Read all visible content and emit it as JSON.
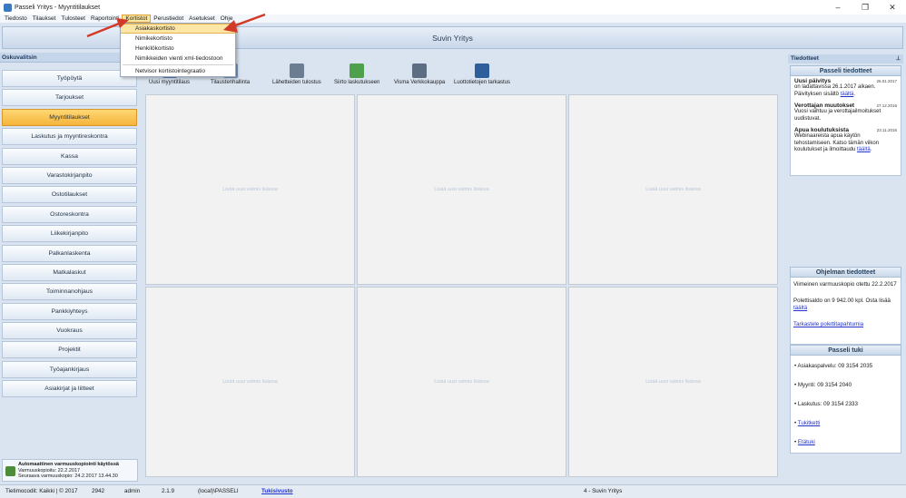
{
  "window": {
    "title": "Passeli Yritys - Myyntitilaukset",
    "minimize": "–",
    "maximize": "❐",
    "close": "✕"
  },
  "menubar": {
    "items": [
      "Tiedosto",
      "Tilaukset",
      "Tulosteet",
      "Raportointi",
      "Kortistot",
      "Perustiedot",
      "Asetukset",
      "Ohje"
    ],
    "active_index": 4
  },
  "dropdown": {
    "items": [
      "Asiakaskortisto",
      "Nimikekortisto",
      "Henkilökortisto",
      "Nimikkeiden vienti xml-tiedostoon",
      "Netvisor kortistointegraatio"
    ],
    "highlighted_index": 0
  },
  "company": {
    "name": "Suvin Yritys"
  },
  "left_panel": {
    "header": "Oskuvalitsin",
    "nav": [
      "Työpöytä",
      "Tarjoukset",
      "Myyntitilaukset",
      "Laskutus ja myyntireskontra",
      "Kassa",
      "Varastokirjanpito",
      "Ostotilaukset",
      "Ostoreskontra",
      "Liikekirjanpito",
      "Palkanlaskenta",
      "Matkalaskut",
      "Toiminnanohjaus",
      "Pankkiyhteys",
      "Vuokraus",
      "Projektit",
      "Työajankirjaus",
      "Asiakirjat ja liitteet"
    ],
    "active_index": 2,
    "backup": {
      "line1": "Automaattinen varmuuskopiointi käytössä",
      "line2": "Varmuuskopioitu: 22.2.2017",
      "line3": "Seuraava varmuuskopio: 24.2.2017 13.44.30"
    }
  },
  "toolbar": {
    "tools": [
      {
        "label": "Uusi myyntitilaus",
        "icon": "new-order-icon",
        "color": "#5a86c0"
      },
      {
        "label": "Tilaustenhallinta",
        "icon": "order-management-icon",
        "color": "#7a9cc8"
      },
      {
        "label": "Lähetteiden tulostus",
        "icon": "print-shipments-icon",
        "color": "#6c7d92"
      },
      {
        "label": "Siirto laskutukseen",
        "icon": "transfer-billing-icon",
        "color": "#4fa04a"
      },
      {
        "label": "Visma Verkkokauppa",
        "icon": "webshop-icon",
        "color": "#5d6d82"
      },
      {
        "label": "Luottotietojen tarkastus",
        "icon": "credit-check-icon",
        "color": "#2f5f9a"
      }
    ]
  },
  "grid": {
    "cells": [
      "Lisää uusi valmis lisäosa",
      "Lisää uusi valmis lisäosa",
      "Lisää uusi valmis lisäosa",
      "Lisää uusi valmis lisäosa",
      "Lisää uusi valmis lisäosa",
      "Lisää uusi valmis lisäosa"
    ]
  },
  "right_panel": {
    "header": "Tiedotteet",
    "pin": "⊥",
    "news_title": "Passeli tiedotteet",
    "news": [
      {
        "title": "Uusi päivitys",
        "date": "26.01.2017",
        "body": "on ladattavissa 26.1.2017 alkaen. Päivityksen sisältö ",
        "link": "täältä",
        "tail": "."
      },
      {
        "title": "Verottajan muutokset",
        "date": "27.12.2016",
        "body": "Vuosi vaihtuu ja verottajailmoitukset uudistuvat.",
        "link": "",
        "tail": ""
      },
      {
        "title": "Apua koulutuksista",
        "date": "23.11.2016",
        "body": "Webinaareista apua käytön tehostamiseen. Katso tämän viikon koulutukset ja ilmoittaudu ",
        "link": "täältä",
        "tail": "."
      }
    ],
    "program_title": "Ohjelman tiedotteet",
    "program": {
      "backup_line": "Viimeinen varmuuskopio otettu 22.2.2017",
      "balance_line": "Polettisaldo on 9 942.00 kpl. Osta lisää",
      "balance_link": "täältä",
      "events_link": "Tarkastele polettitapahtumia"
    },
    "support_title": "Passeli tuki",
    "support": [
      {
        "text": "• Asiakaspalvelu: 09 3154 2035",
        "is_link": false
      },
      {
        "text": "• Myynti: 09 3154 2040",
        "is_link": false
      },
      {
        "text": "• Laskutus: 09 3154 2333",
        "is_link": false
      },
      {
        "text": "Tukitketti",
        "is_link": true
      },
      {
        "text": "Etätuki",
        "is_link": true
      }
    ]
  },
  "statusbar": {
    "codes": "Tietimocodit: Kaikki | © 2017",
    "number": "2942",
    "user": "admin",
    "version": "2.1.9",
    "db": "(local)\\PASSELI",
    "support": "Tukisivusto",
    "company": "4 - Suvin Yritys"
  },
  "colors": {
    "accent": "#f5b43a",
    "arrow": "#d23a28",
    "link": "#2233cc"
  }
}
